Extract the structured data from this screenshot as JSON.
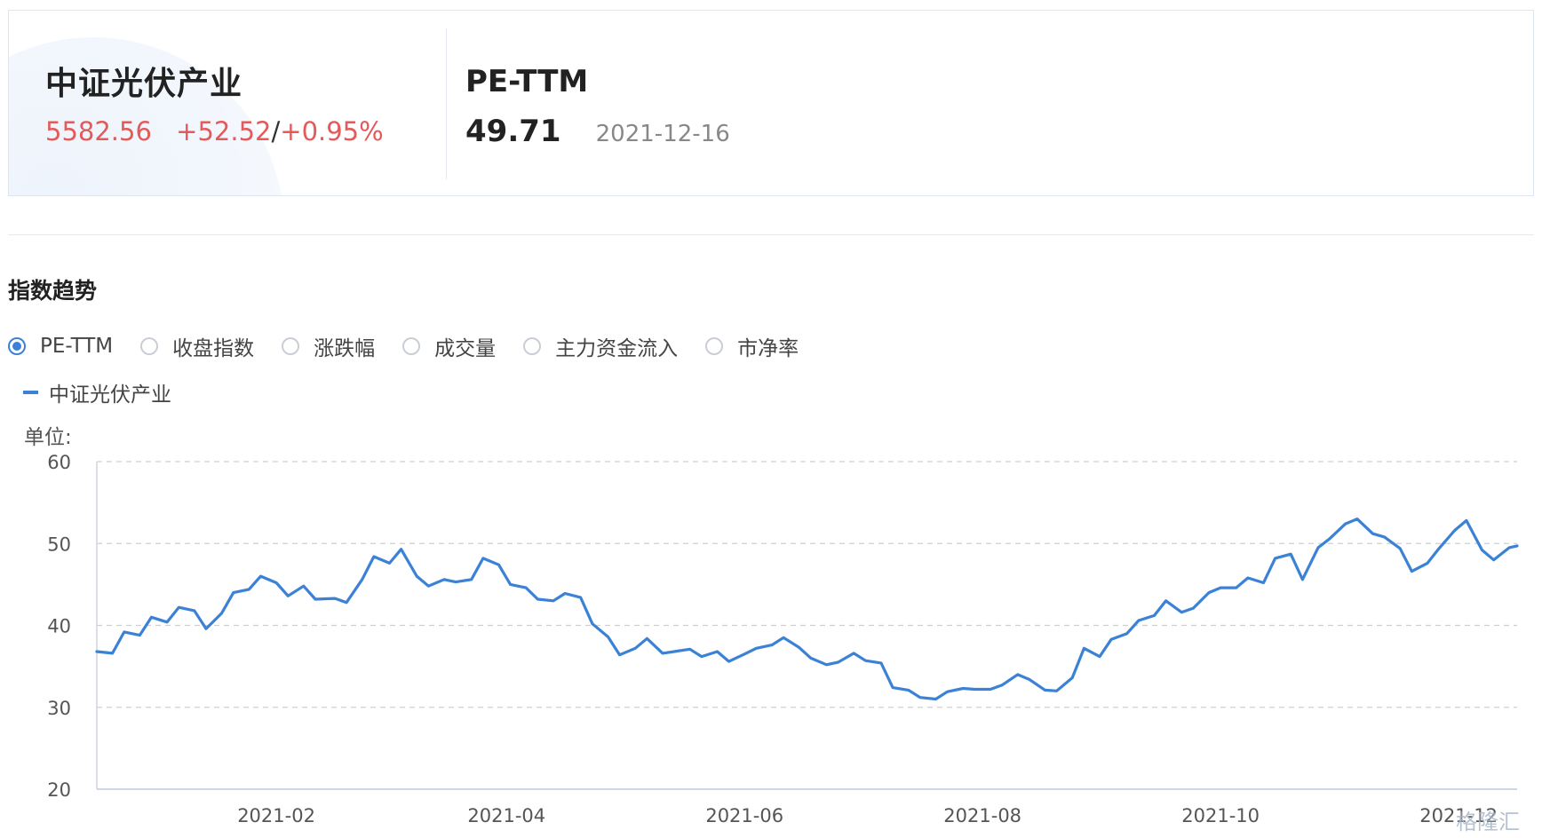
{
  "header": {
    "index_name": "中证光伏产业",
    "price": "5582.56",
    "change": "+52.52",
    "change_sep": "/",
    "change_pct": "+0.95%",
    "metric_name": "PE-TTM",
    "metric_value": "49.71",
    "metric_date": "2021-12-16"
  },
  "section": {
    "title": "指数趋势"
  },
  "tabs": [
    {
      "label": "PE-TTM",
      "checked": true
    },
    {
      "label": "收盘指数",
      "checked": false
    },
    {
      "label": "涨跌幅",
      "checked": false
    },
    {
      "label": "成交量",
      "checked": false
    },
    {
      "label": "主力资金流入",
      "checked": false
    },
    {
      "label": "市净率",
      "checked": false
    }
  ],
  "colors": {
    "line": "#3b82d6",
    "up": "#e25a5a"
  },
  "watermark": "格隆汇",
  "chart_data": {
    "type": "line",
    "unit_label": "单位:",
    "ylim": [
      20,
      60
    ],
    "yticks": [
      20,
      30,
      40,
      50,
      60
    ],
    "xlim": [
      "2020-12-17",
      "2021-12-16"
    ],
    "xticks": [
      "2021-02",
      "2021-04",
      "2021-06",
      "2021-08",
      "2021-10",
      "2021-12"
    ],
    "grid": true,
    "legend_position": "top-left",
    "series": [
      {
        "name": "中证光伏产业",
        "points": [
          [
            "2020-12-17",
            36.8
          ],
          [
            "2020-12-21",
            36.6
          ],
          [
            "2020-12-24",
            39.2
          ],
          [
            "2020-12-28",
            38.8
          ],
          [
            "2020-12-31",
            41.0
          ],
          [
            "2021-01-04",
            40.4
          ],
          [
            "2021-01-07",
            42.2
          ],
          [
            "2021-01-11",
            41.8
          ],
          [
            "2021-01-14",
            39.6
          ],
          [
            "2021-01-18",
            41.5
          ],
          [
            "2021-01-21",
            44.0
          ],
          [
            "2021-01-25",
            44.4
          ],
          [
            "2021-01-28",
            46.0
          ],
          [
            "2021-02-01",
            45.2
          ],
          [
            "2021-02-04",
            43.6
          ],
          [
            "2021-02-08",
            44.8
          ],
          [
            "2021-02-11",
            43.2
          ],
          [
            "2021-02-16",
            43.3
          ],
          [
            "2021-02-19",
            42.8
          ],
          [
            "2021-02-23",
            45.6
          ],
          [
            "2021-02-26",
            48.4
          ],
          [
            "2021-03-02",
            47.6
          ],
          [
            "2021-03-05",
            49.3
          ],
          [
            "2021-03-09",
            46.0
          ],
          [
            "2021-03-12",
            44.8
          ],
          [
            "2021-03-16",
            45.6
          ],
          [
            "2021-03-19",
            45.3
          ],
          [
            "2021-03-23",
            45.6
          ],
          [
            "2021-03-26",
            48.2
          ],
          [
            "2021-03-30",
            47.4
          ],
          [
            "2021-04-02",
            45.0
          ],
          [
            "2021-04-06",
            44.6
          ],
          [
            "2021-04-09",
            43.2
          ],
          [
            "2021-04-13",
            43.0
          ],
          [
            "2021-04-16",
            43.9
          ],
          [
            "2021-04-20",
            43.4
          ],
          [
            "2021-04-23",
            40.2
          ],
          [
            "2021-04-27",
            38.6
          ],
          [
            "2021-04-30",
            36.4
          ],
          [
            "2021-05-04",
            37.2
          ],
          [
            "2021-05-07",
            38.4
          ],
          [
            "2021-05-11",
            36.6
          ],
          [
            "2021-05-14",
            36.8
          ],
          [
            "2021-05-18",
            37.1
          ],
          [
            "2021-05-21",
            36.2
          ],
          [
            "2021-05-25",
            36.8
          ],
          [
            "2021-05-28",
            35.6
          ],
          [
            "2021-06-01",
            36.5
          ],
          [
            "2021-06-04",
            37.2
          ],
          [
            "2021-06-08",
            37.6
          ],
          [
            "2021-06-11",
            38.5
          ],
          [
            "2021-06-15",
            37.3
          ],
          [
            "2021-06-18",
            36.0
          ],
          [
            "2021-06-22",
            35.2
          ],
          [
            "2021-06-25",
            35.5
          ],
          [
            "2021-06-29",
            36.6
          ],
          [
            "2021-07-02",
            35.7
          ],
          [
            "2021-07-06",
            35.4
          ],
          [
            "2021-07-09",
            32.4
          ],
          [
            "2021-07-13",
            32.1
          ],
          [
            "2021-07-16",
            31.2
          ],
          [
            "2021-07-20",
            31.0
          ],
          [
            "2021-07-23",
            31.9
          ],
          [
            "2021-07-27",
            32.3
          ],
          [
            "2021-07-30",
            32.2
          ],
          [
            "2021-08-03",
            32.2
          ],
          [
            "2021-08-06",
            32.7
          ],
          [
            "2021-08-10",
            34.0
          ],
          [
            "2021-08-13",
            33.4
          ],
          [
            "2021-08-17",
            32.1
          ],
          [
            "2021-08-20",
            32.0
          ],
          [
            "2021-08-24",
            33.6
          ],
          [
            "2021-08-27",
            37.2
          ],
          [
            "2021-08-31",
            36.2
          ],
          [
            "2021-09-03",
            38.3
          ],
          [
            "2021-09-07",
            39.0
          ],
          [
            "2021-09-10",
            40.6
          ],
          [
            "2021-09-14",
            41.2
          ],
          [
            "2021-09-17",
            43.0
          ],
          [
            "2021-09-21",
            41.6
          ],
          [
            "2021-09-24",
            42.1
          ],
          [
            "2021-09-28",
            44.0
          ],
          [
            "2021-10-01",
            44.6
          ],
          [
            "2021-10-05",
            44.6
          ],
          [
            "2021-10-08",
            45.8
          ],
          [
            "2021-10-12",
            45.2
          ],
          [
            "2021-10-15",
            48.2
          ],
          [
            "2021-10-19",
            48.7
          ],
          [
            "2021-10-22",
            45.6
          ],
          [
            "2021-10-26",
            49.5
          ],
          [
            "2021-10-29",
            50.6
          ],
          [
            "2021-11-02",
            52.4
          ],
          [
            "2021-11-05",
            53.0
          ],
          [
            "2021-11-09",
            51.2
          ],
          [
            "2021-11-12",
            50.8
          ],
          [
            "2021-11-16",
            49.4
          ],
          [
            "2021-11-19",
            46.6
          ],
          [
            "2021-11-23",
            47.6
          ],
          [
            "2021-11-26",
            49.4
          ],
          [
            "2021-11-30",
            51.6
          ],
          [
            "2021-12-03",
            52.8
          ],
          [
            "2021-12-07",
            49.2
          ],
          [
            "2021-12-10",
            48.0
          ],
          [
            "2021-12-14",
            49.5
          ],
          [
            "2021-12-16",
            49.71
          ]
        ]
      }
    ]
  }
}
